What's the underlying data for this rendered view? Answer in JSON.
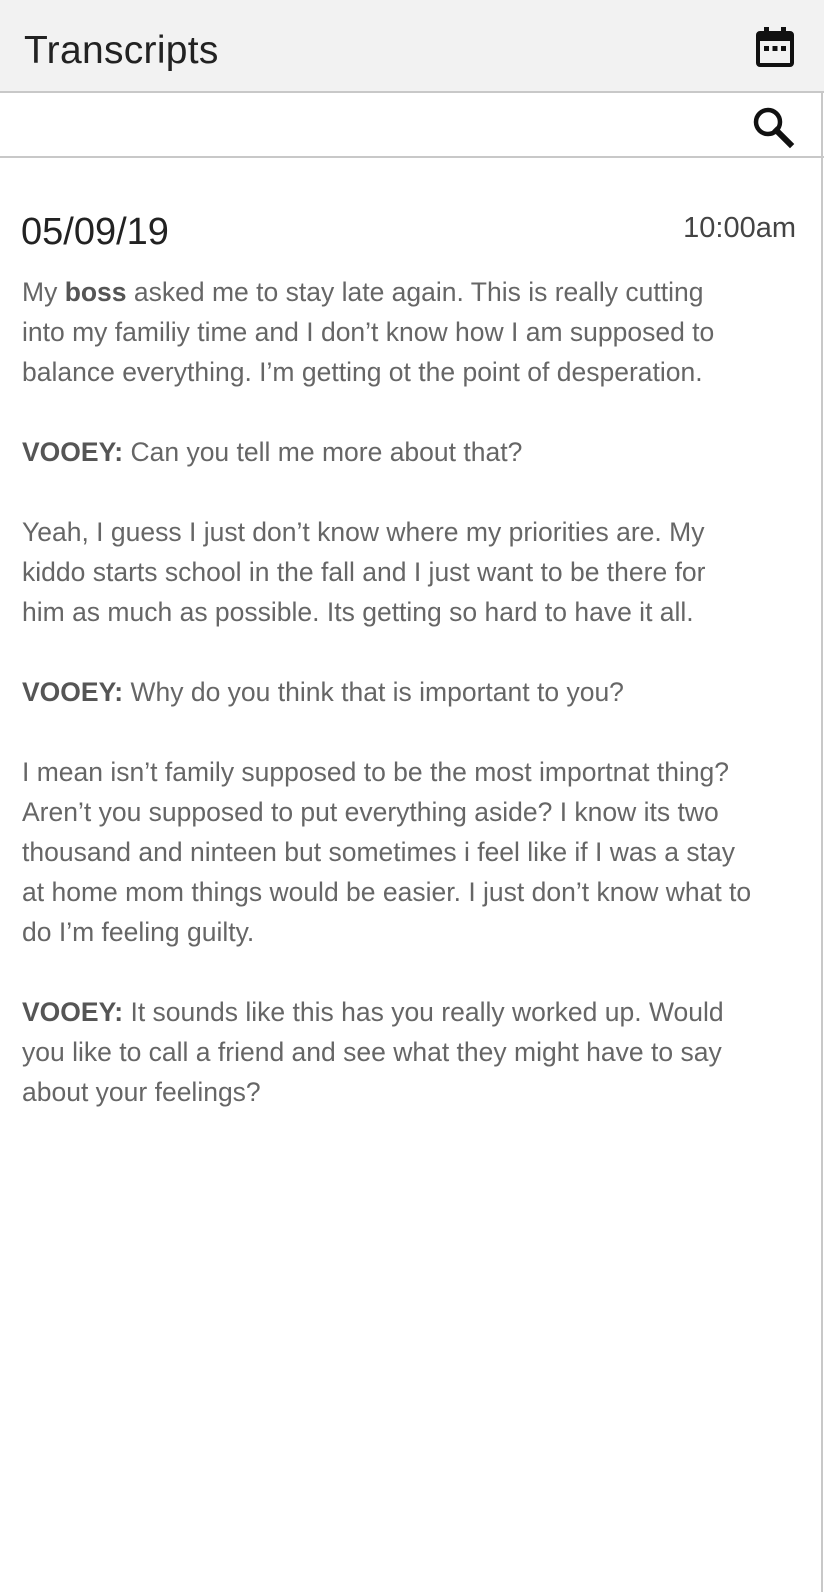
{
  "header": {
    "title": "Transcripts",
    "calendar_icon": "calendar-icon"
  },
  "search": {
    "value": "",
    "placeholder": "",
    "icon": "search-icon"
  },
  "entry": {
    "date": "05/09/19",
    "time": "10:00am",
    "messages": [
      {
        "speaker": "",
        "pre": "My ",
        "highlight": "boss",
        "text": " asked me to stay late again. This is really cutting into my familiy time and I don’t know how I am supposed to balance everything. I’m getting ot the point of desperation."
      },
      {
        "speaker": "VOOEY:",
        "text": " Can you tell me more about that?"
      },
      {
        "speaker": "",
        "text": "Yeah, I guess I just don’t know where my priorities are. My kiddo starts school in the fall and I just want to be there for him as much as possible. Its getting so hard to have it all."
      },
      {
        "speaker": "VOOEY:",
        "text": " Why do you think that is important to you?"
      },
      {
        "speaker": "",
        "text": "I mean isn’t family supposed to be the most importnat thing? Aren’t you supposed to put everything aside? I know its two thousand and ninteen but sometimes i feel like if I was a stay at home mom things would be easier. I just don’t know what to do I’m feeling guilty."
      },
      {
        "speaker": "VOOEY:",
        "text": " It sounds like this has you really worked up. Would you like to call a friend and see what they might have to say about your feelings?"
      }
    ]
  }
}
